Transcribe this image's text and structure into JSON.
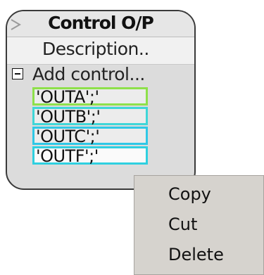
{
  "node": {
    "title": "Control O/P",
    "description": "Description..",
    "add_control": "Add control...",
    "outputs": [
      {
        "label": "'OUTA';'",
        "color": "#8ee04a"
      },
      {
        "label": "'OUTB';'",
        "color": "#3fd6d8"
      },
      {
        "label": "'OUTC';'",
        "color": "#2fc8e6"
      },
      {
        "label": "'OUTF';'",
        "color": "#2fd0e0"
      }
    ]
  },
  "context_menu": {
    "items": [
      "Copy",
      "Cut",
      "Delete"
    ]
  }
}
